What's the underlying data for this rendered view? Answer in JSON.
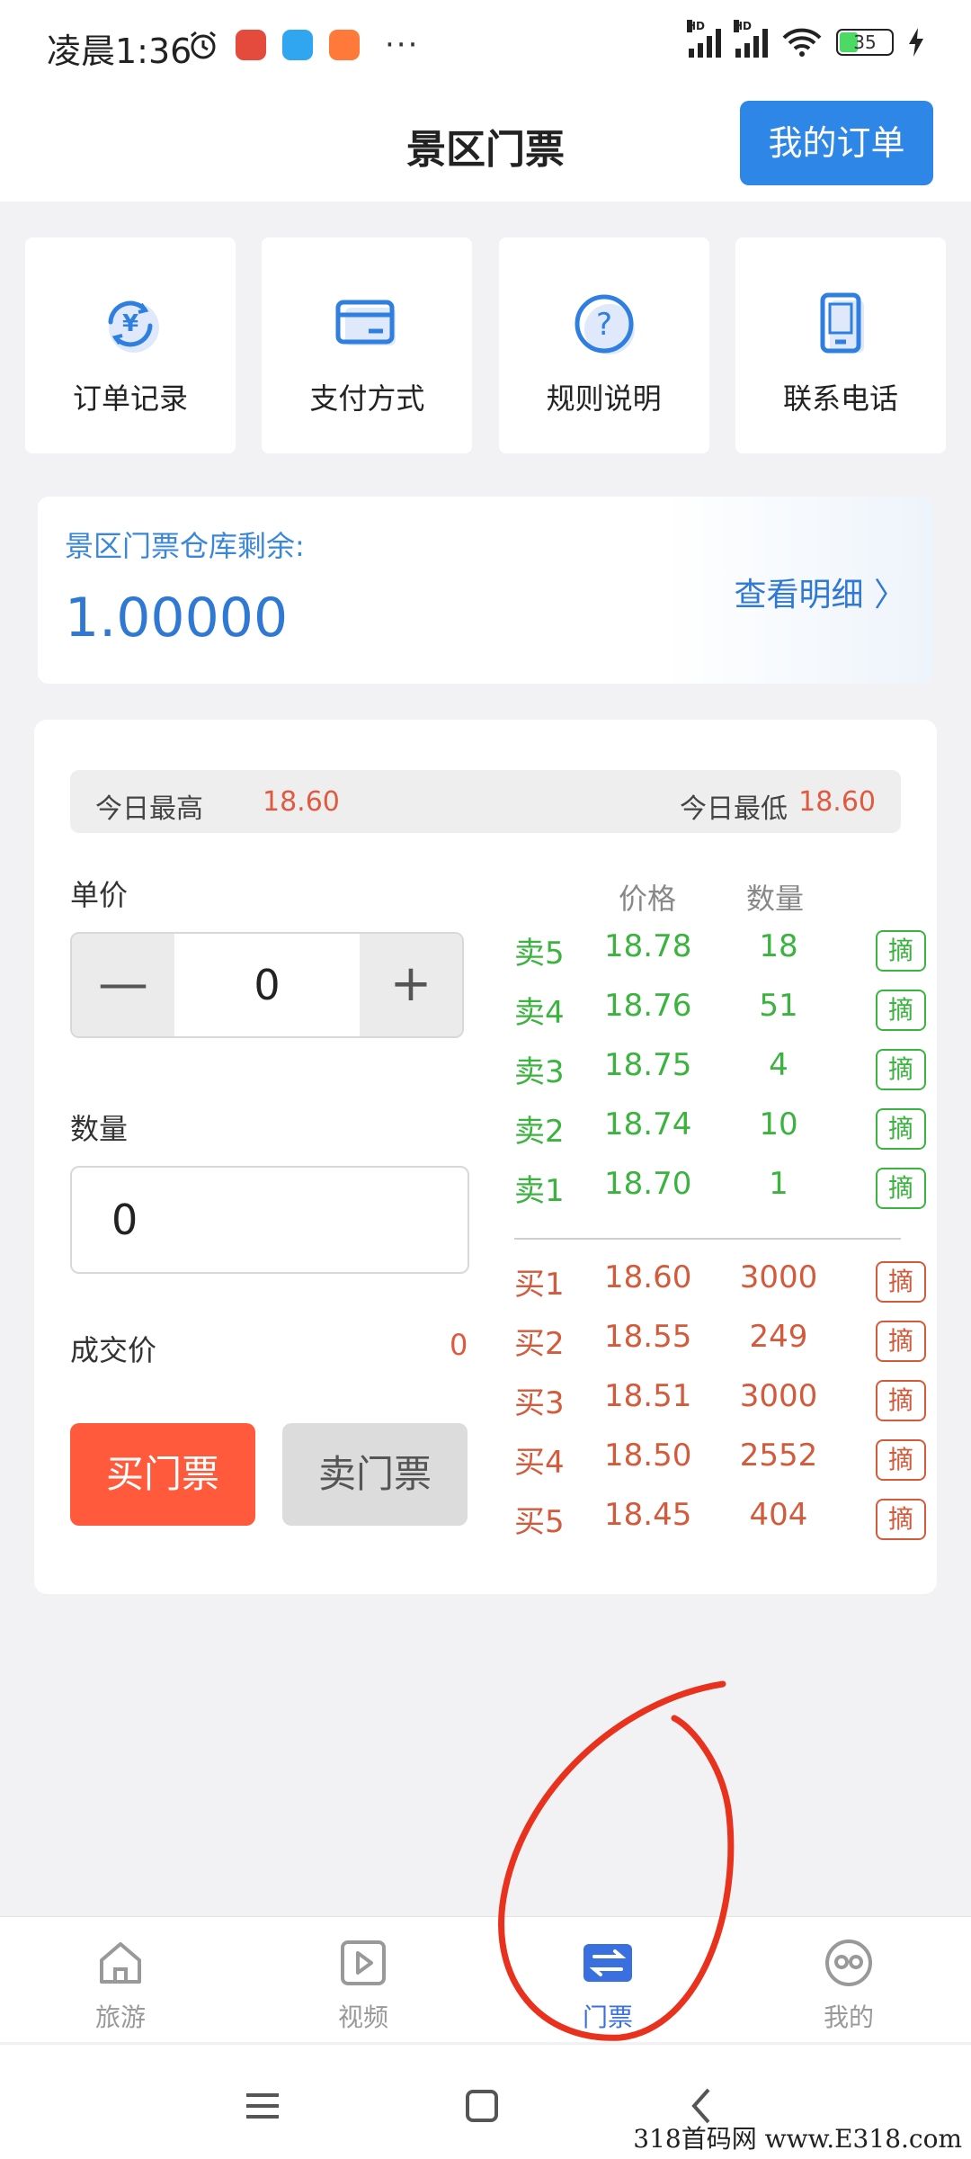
{
  "status_bar": {
    "time": "凌晨1:36",
    "more": "···",
    "battery": "35"
  },
  "header": {
    "title": "景区门票",
    "my_orders": "我的订单"
  },
  "quick_actions": [
    {
      "label": "订单记录",
      "icon": "yen-refresh-icon"
    },
    {
      "label": "支付方式",
      "icon": "card-icon"
    },
    {
      "label": "规则说明",
      "icon": "question-icon"
    },
    {
      "label": "联系电话",
      "icon": "phone-icon"
    }
  ],
  "inventory": {
    "label": "景区门票仓库剩余:",
    "value": "1.00000",
    "link": "查看明细 〉"
  },
  "trade": {
    "high_label": "今日最高",
    "high_value": "18.60",
    "low_label": "今日最低",
    "low_value": "18.60",
    "unit_price_label": "单价",
    "minus": "—",
    "plus": "+",
    "unit_price_value": "0",
    "quantity_label": "数量",
    "quantity_value": "0",
    "deal_price_label": "成交价",
    "deal_price_value": "0",
    "buy_button": "买门票",
    "sell_button": "卖门票"
  },
  "order_book": {
    "price_header": "价格",
    "qty_header": "数量",
    "take_label": "摘",
    "asks": [
      {
        "side": "卖5",
        "price": "18.78",
        "qty": "18"
      },
      {
        "side": "卖4",
        "price": "18.76",
        "qty": "51"
      },
      {
        "side": "卖3",
        "price": "18.75",
        "qty": "4"
      },
      {
        "side": "卖2",
        "price": "18.74",
        "qty": "10"
      },
      {
        "side": "卖1",
        "price": "18.70",
        "qty": "1"
      }
    ],
    "bids": [
      {
        "side": "买1",
        "price": "18.60",
        "qty": "3000"
      },
      {
        "side": "买2",
        "price": "18.55",
        "qty": "249"
      },
      {
        "side": "买3",
        "price": "18.51",
        "qty": "3000"
      },
      {
        "side": "买4",
        "price": "18.50",
        "qty": "2552"
      },
      {
        "side": "买5",
        "price": "18.45",
        "qty": "404"
      }
    ]
  },
  "bottom_nav": [
    {
      "label": "旅游",
      "icon": "home-icon",
      "active": false
    },
    {
      "label": "视频",
      "icon": "play-icon",
      "active": false
    },
    {
      "label": "门票",
      "icon": "exchange-icon",
      "active": true
    },
    {
      "label": "我的",
      "icon": "profile-icon",
      "active": false
    }
  ],
  "watermark": "318首码网 www.E318.com",
  "colors": {
    "accent": "#2e87e6",
    "ask": "#3bb33f",
    "bid": "#d45a3c",
    "buy_button": "#ff5a3c",
    "nav_active": "#3a6fe0",
    "annotation": "#e8321e"
  }
}
